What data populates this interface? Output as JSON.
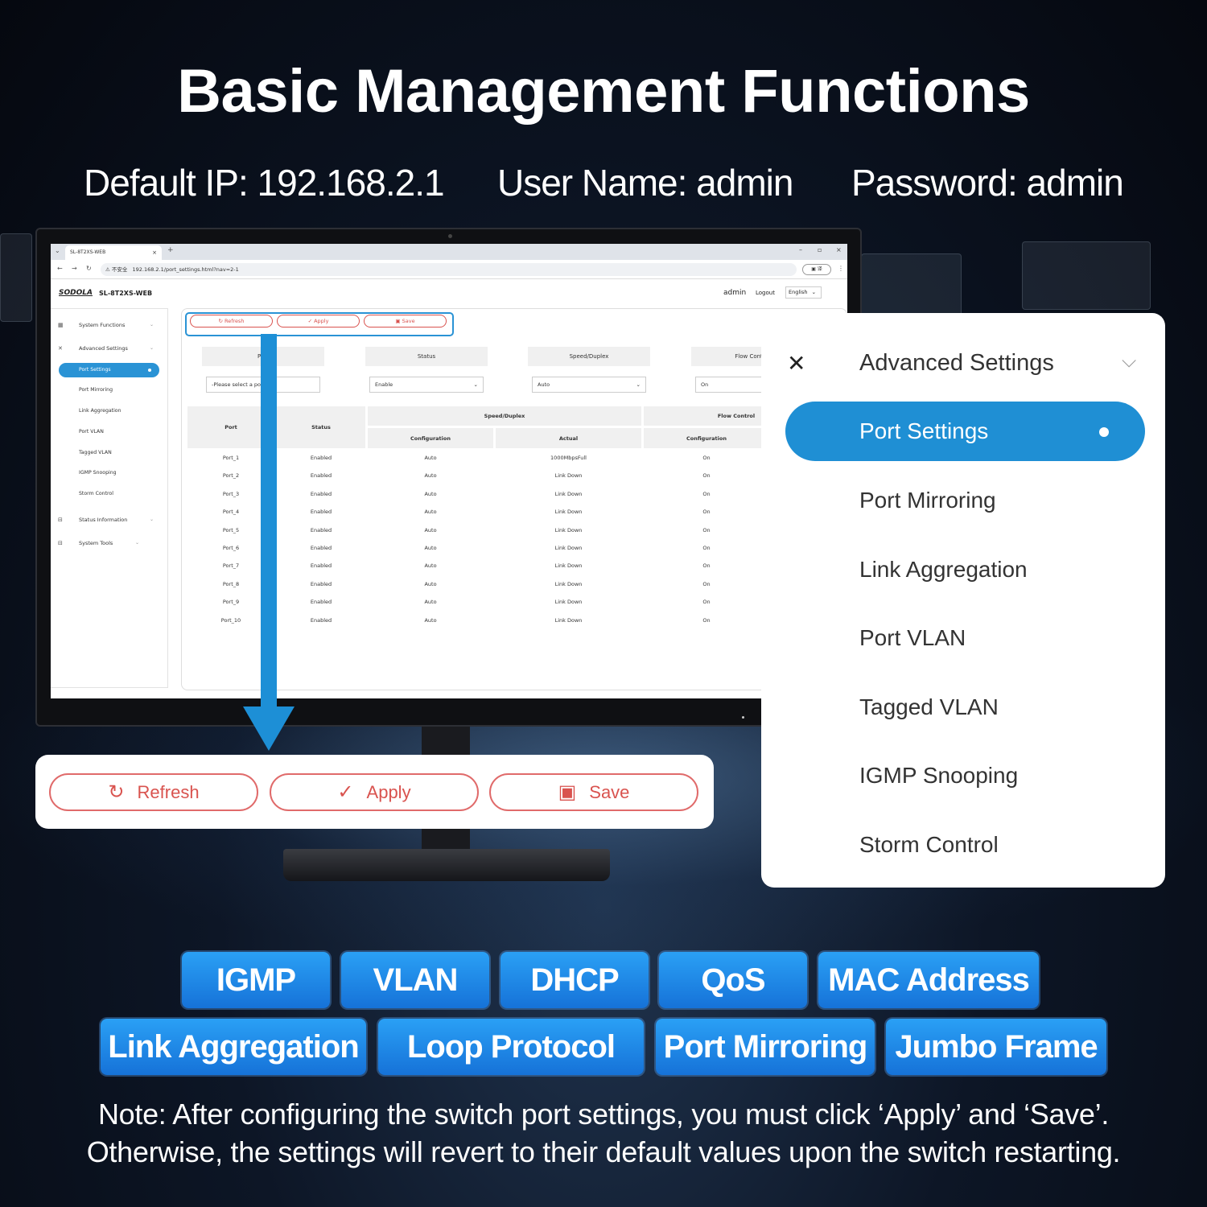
{
  "headline": "Basic Management Functions",
  "credentials": {
    "ip": "Default IP: 192.168.2.1",
    "user": "User Name: admin",
    "password": "Password: admin"
  },
  "browser": {
    "tab_title": "SL-8T2XS-WEB",
    "address_security": "不安全",
    "url": "192.168.2.1/port_settings.html?nav=2-1"
  },
  "app": {
    "logo": "SODOLA",
    "model": "SL-8T2XS-WEB",
    "user": "admin",
    "logout": "Logout",
    "language": "English"
  },
  "sidebar": {
    "groups": [
      {
        "label": "System Functions",
        "icon": "grid-icon"
      },
      {
        "label": "Advanced Settings",
        "icon": "tools-icon"
      },
      {
        "label": "Status Information",
        "icon": "info-icon"
      },
      {
        "label": "System Tools",
        "icon": "toolbox-icon"
      }
    ],
    "active": "Port Settings",
    "subitems": [
      "Port Mirroring",
      "Link Aggregation",
      "Port VLAN",
      "Tagged VLAN",
      "IGMP Snooping",
      "Storm Control"
    ]
  },
  "toolbar": {
    "refresh": "Refresh",
    "apply": "Apply",
    "save": "Save"
  },
  "config": {
    "headers": [
      "Port",
      "Status",
      "Speed/Duplex",
      "Flow Control"
    ],
    "port_placeholder": "-Please select a port-",
    "status_value": "Enable",
    "speed_value": "Auto",
    "flow_value": "On"
  },
  "table": {
    "col_port": "Port",
    "col_status": "Status",
    "col_speed": "Speed/Duplex",
    "col_flow": "Flow Control",
    "sub_config": "Configuration",
    "sub_actual": "Actual",
    "rows": [
      {
        "port": "Port_1",
        "status": "Enabled",
        "config": "Auto",
        "actual": "1000MbpsFull",
        "flow": "On"
      },
      {
        "port": "Port_2",
        "status": "Enabled",
        "config": "Auto",
        "actual": "Link Down",
        "flow": "On"
      },
      {
        "port": "Port_3",
        "status": "Enabled",
        "config": "Auto",
        "actual": "Link Down",
        "flow": "On"
      },
      {
        "port": "Port_4",
        "status": "Enabled",
        "config": "Auto",
        "actual": "Link Down",
        "flow": "On"
      },
      {
        "port": "Port_5",
        "status": "Enabled",
        "config": "Auto",
        "actual": "Link Down",
        "flow": "On"
      },
      {
        "port": "Port_6",
        "status": "Enabled",
        "config": "Auto",
        "actual": "Link Down",
        "flow": "On"
      },
      {
        "port": "Port_7",
        "status": "Enabled",
        "config": "Auto",
        "actual": "Link Down",
        "flow": "On"
      },
      {
        "port": "Port_8",
        "status": "Enabled",
        "config": "Auto",
        "actual": "Link Down",
        "flow": "On"
      },
      {
        "port": "Port_9",
        "status": "Enabled",
        "config": "Auto",
        "actual": "Link Down",
        "flow": "On"
      },
      {
        "port": "Port_10",
        "status": "Enabled",
        "config": "Auto",
        "actual": "Link Down",
        "flow": "On"
      }
    ]
  },
  "zoom_menu": {
    "header": "Advanced Settings",
    "active": "Port Settings",
    "items": [
      "Port Mirroring",
      "Link Aggregation",
      "Port VLAN",
      "Tagged VLAN",
      "IGMP Snooping",
      "Storm Control"
    ]
  },
  "features": {
    "row1": [
      "IGMP",
      "VLAN",
      "DHCP",
      "QoS",
      "MAC Address"
    ],
    "row2": [
      "Link Aggregation",
      "Loop Protocol",
      "Port Mirroring",
      "Jumbo Frame"
    ]
  },
  "note": {
    "line1": "Note: After configuring the switch port settings, you must click ‘Apply’ and ‘Save’.",
    "line2": "Otherwise, the settings will revert to their default values upon the switch restarting."
  },
  "colors": {
    "accent": "#1f8fd4",
    "button_red": "#d9534f",
    "pill_top": "#2aa0f5",
    "pill_bottom": "#1672d8"
  }
}
